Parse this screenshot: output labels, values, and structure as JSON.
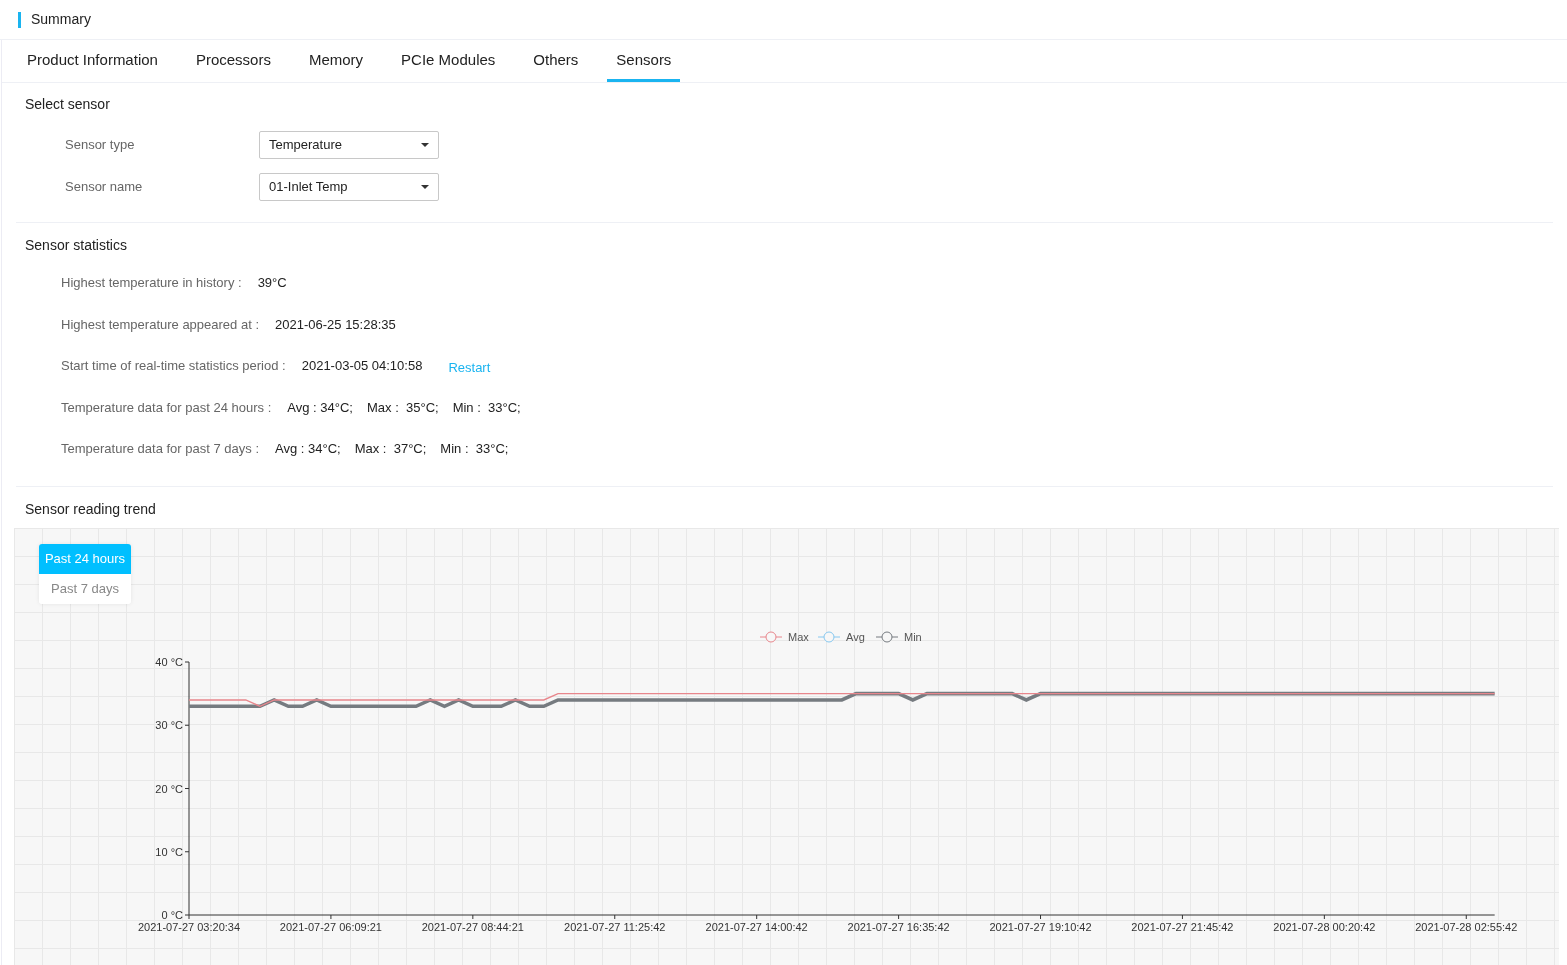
{
  "header": {
    "title": "Summary"
  },
  "tabs": [
    {
      "label": "Product Information",
      "selected": false
    },
    {
      "label": "Processors",
      "selected": false
    },
    {
      "label": "Memory",
      "selected": false
    },
    {
      "label": "PCIe Modules",
      "selected": false
    },
    {
      "label": "Others",
      "selected": false
    },
    {
      "label": "Sensors",
      "selected": true
    }
  ],
  "select_sensor": {
    "title": "Select sensor",
    "fields": [
      {
        "label": "Sensor type",
        "value": "Temperature"
      },
      {
        "label": "Sensor name",
        "value": "01-Inlet Temp"
      }
    ]
  },
  "statistics": {
    "title": "Sensor statistics",
    "rows": [
      {
        "label": "Highest temperature in history :",
        "values": [
          "39°C"
        ]
      },
      {
        "label": "Highest temperature appeared at :",
        "values": [
          "2021-06-25 15:28:35"
        ]
      },
      {
        "label": "Start time of real-time statistics period :",
        "values": [
          "2021-03-05 04:10:58"
        ],
        "link": "Restart"
      },
      {
        "label": "Temperature data for past 24 hours :",
        "values": [
          "Avg : 34°C;",
          "Max :  35°C;",
          "Min :  33°C;"
        ]
      },
      {
        "label": "Temperature data for past 7 days :",
        "values": [
          "Avg : 34°C;",
          "Max :  37°C;",
          "Min :  33°C;"
        ]
      }
    ]
  },
  "trend": {
    "title": "Sensor reading trend",
    "ranges": [
      {
        "label": "Past 24 hours",
        "selected": true
      },
      {
        "label": "Past 7 days",
        "selected": false
      }
    ],
    "chart_data": {
      "type": "line",
      "categories": [
        "2021-07-27 03:20:34",
        null,
        null,
        null,
        null,
        null,
        null,
        null,
        null,
        null,
        "2021-07-27 06:09:21",
        null,
        null,
        null,
        null,
        null,
        null,
        null,
        null,
        null,
        "2021-07-27 08:44:21",
        null,
        null,
        null,
        null,
        null,
        null,
        null,
        null,
        null,
        "2021-07-27 11:25:42",
        null,
        null,
        null,
        null,
        null,
        null,
        null,
        null,
        null,
        "2021-07-27 14:00:42",
        null,
        null,
        null,
        null,
        null,
        null,
        null,
        null,
        null,
        "2021-07-27 16:35:42",
        null,
        null,
        null,
        null,
        null,
        null,
        null,
        null,
        null,
        "2021-07-27 19:10:42",
        null,
        null,
        null,
        null,
        null,
        null,
        null,
        null,
        null,
        "2021-07-27 21:45:42",
        null,
        null,
        null,
        null,
        null,
        null,
        null,
        null,
        null,
        "2021-07-28 00:20:42",
        null,
        null,
        null,
        null,
        null,
        null,
        null,
        null,
        null,
        "2021-07-28 02:55:42",
        null,
        null
      ],
      "series": [
        {
          "name": "Max",
          "color": "#e8868c",
          "values": [
            34,
            34,
            34,
            34,
            34,
            33,
            34,
            34,
            34,
            34,
            34,
            34,
            34,
            34,
            34,
            34,
            34,
            34,
            34,
            34,
            34,
            34,
            34,
            34,
            34,
            34,
            35,
            35,
            35,
            35,
            35,
            35,
            35,
            35,
            35,
            35,
            35,
            35,
            35,
            35,
            35,
            35,
            35,
            35,
            35,
            35,
            35,
            35,
            35,
            35,
            35,
            35,
            35,
            35,
            35,
            35,
            35,
            35,
            35,
            35,
            35,
            35,
            35,
            35,
            35,
            35,
            35,
            35,
            35,
            35,
            35,
            35,
            35,
            35,
            35,
            35,
            35,
            35,
            35,
            35,
            35,
            35,
            35,
            35,
            35,
            35,
            35,
            35,
            35,
            35,
            35,
            35,
            35
          ]
        },
        {
          "name": "Avg",
          "color": "#87c8f0",
          "values": [
            null,
            null,
            null,
            null,
            null,
            null,
            null,
            null,
            null,
            null,
            null,
            null,
            null,
            null,
            null,
            null,
            null,
            null,
            null,
            null,
            null,
            null,
            null,
            null,
            null,
            null,
            null,
            null,
            null,
            null,
            null,
            null,
            null,
            null,
            null,
            null,
            null,
            null,
            null,
            null,
            null,
            null,
            null,
            null,
            null,
            null,
            null,
            null,
            null,
            null,
            null,
            null,
            null,
            null,
            null,
            null,
            null,
            null,
            null,
            null,
            null,
            null,
            null,
            null,
            null,
            null,
            null,
            null,
            null,
            null,
            null,
            null,
            null,
            null,
            null,
            null,
            null,
            null,
            null,
            null,
            null,
            null,
            null,
            null,
            null,
            null,
            null,
            null,
            null,
            null,
            null,
            null,
            null
          ]
        },
        {
          "name": "Min",
          "color": "#767b80",
          "values": [
            33,
            33,
            33,
            33,
            33,
            33,
            34,
            33,
            33,
            34,
            33,
            33,
            33,
            33,
            33,
            33,
            33,
            34,
            33,
            34,
            33,
            33,
            33,
            34,
            33,
            33,
            34,
            34,
            34,
            34,
            34,
            34,
            34,
            34,
            34,
            34,
            34,
            34,
            34,
            34,
            34,
            34,
            34,
            34,
            34,
            34,
            34,
            35,
            35,
            35,
            35,
            34,
            35,
            35,
            35,
            35,
            35,
            35,
            35,
            34,
            35,
            35,
            35,
            35,
            35,
            35,
            35,
            35,
            35,
            35,
            35,
            35,
            35,
            35,
            35,
            35,
            35,
            35,
            35,
            35,
            35,
            35,
            35,
            35,
            35,
            35,
            35,
            35,
            35,
            35,
            35,
            35,
            35
          ]
        }
      ],
      "legend": "top",
      "ylim": [
        0,
        40
      ],
      "yticks": [
        {
          "value": 0,
          "label": "0 °C"
        },
        {
          "value": 10,
          "label": "10 °C"
        },
        {
          "value": 20,
          "label": "20 °C"
        },
        {
          "value": 30,
          "label": "30 °C"
        },
        {
          "value": 40,
          "label": "40 °C"
        }
      ]
    }
  }
}
